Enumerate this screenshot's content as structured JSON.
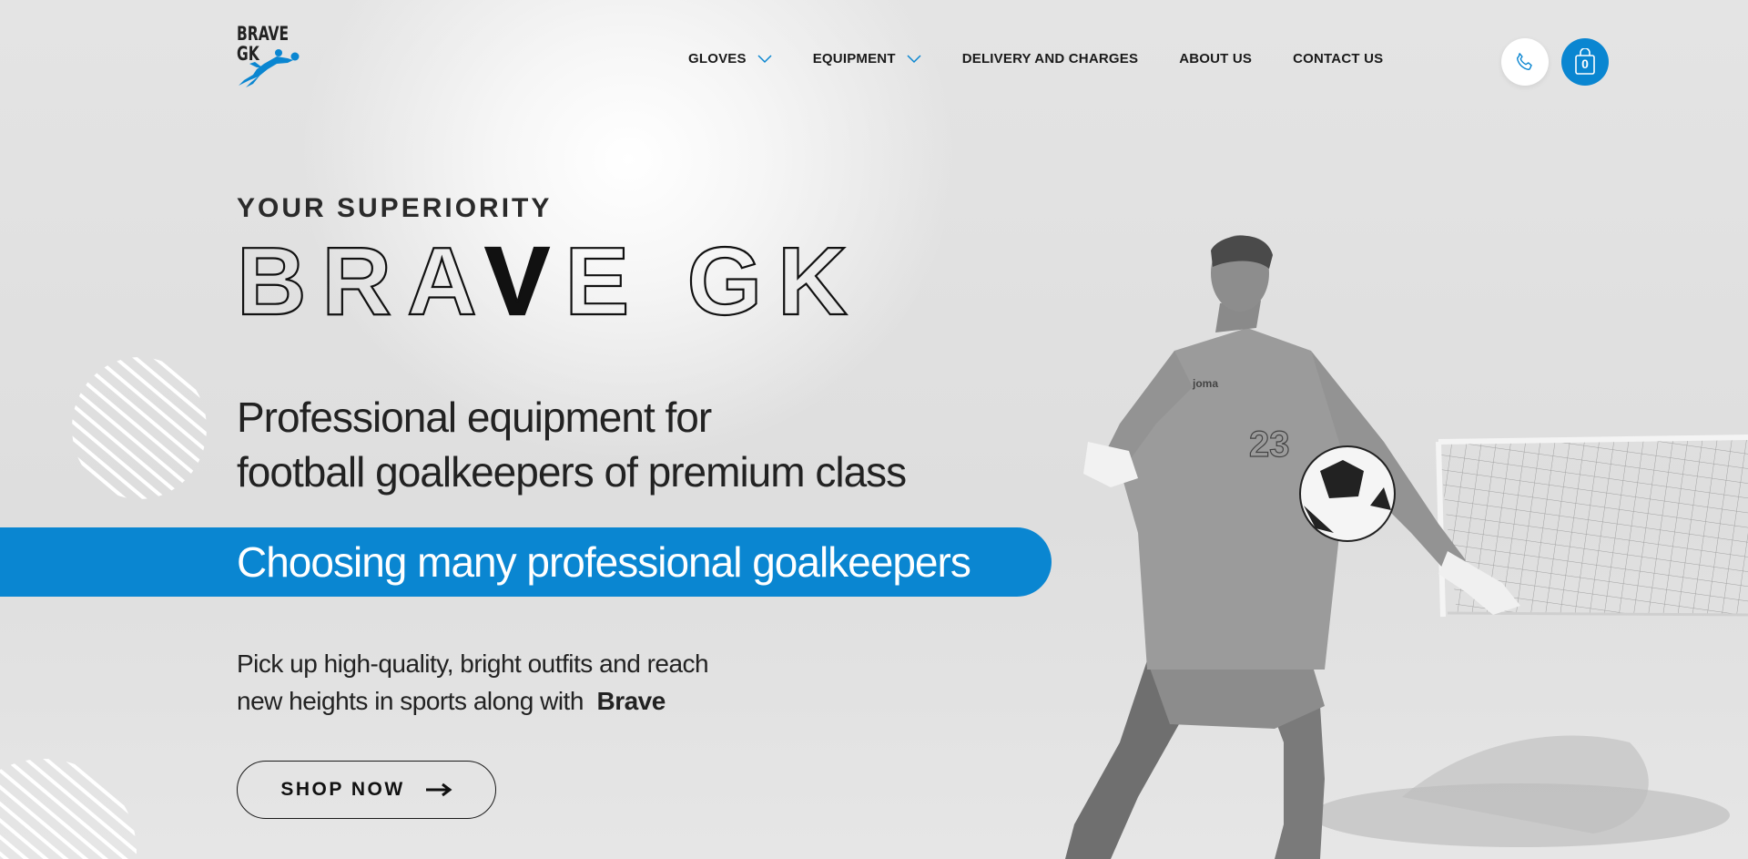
{
  "brand": {
    "logo_text": "BRAVE GK",
    "accent": "#0a86d1"
  },
  "nav": {
    "items": [
      {
        "label": "GLOVES",
        "dropdown": true
      },
      {
        "label": "EQUIPMENT",
        "dropdown": true
      },
      {
        "label": "DELIVERY AND CHARGES",
        "dropdown": false
      },
      {
        "label": "ABOUT US",
        "dropdown": false
      },
      {
        "label": "CONTACT US",
        "dropdown": false
      }
    ]
  },
  "header_actions": {
    "phone_icon": "phone-icon",
    "cart_icon": "shopping-bag-icon",
    "cart_count": "0"
  },
  "hero": {
    "eyebrow": "YOUR SUPERIORITY",
    "title": "BRAVE GK",
    "headline_line1": "Professional equipment for",
    "headline_line2": "football goalkeepers of premium class",
    "banner": "Choosing many professional goalkeepers",
    "sub_line1": "Pick up high-quality, bright outfits and reach",
    "sub_line2": "new heights in sports along with",
    "sub_bold": "Brave",
    "cta_label": "SHOP NOW",
    "cta_icon": "arrow-right-icon",
    "jersey_number": "23",
    "jersey_brand": "joma"
  }
}
